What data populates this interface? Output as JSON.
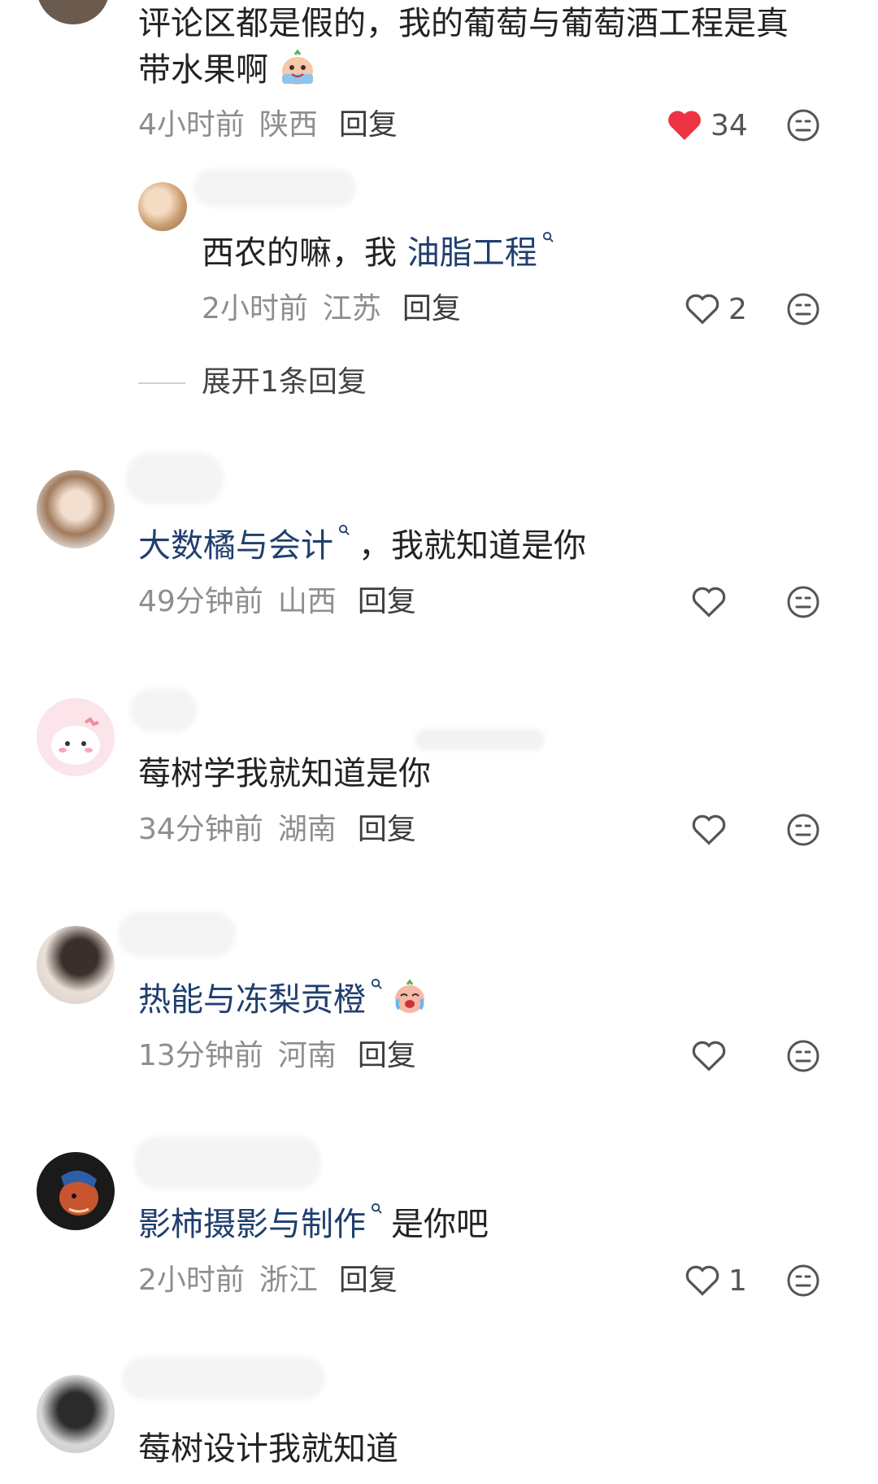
{
  "comments": [
    {
      "text_lines": [
        "评论区都是假的，我的葡萄与葡萄酒工程是真",
        "带水果啊"
      ],
      "time": "4小时前",
      "location": "陕西",
      "reply_label": "回复",
      "likes": "34",
      "liked": true,
      "sub_reply": {
        "mention": "油脂工程",
        "text_prefix": "西农的嘛，我",
        "time": "2小时前",
        "location": "江苏",
        "reply_label": "回复",
        "likes": "2"
      },
      "expand_label": "展开1条回复"
    },
    {
      "mention": "大数橘与会计",
      "text_suffix": "，我就知道是你",
      "time": "49分钟前",
      "location": "山西",
      "reply_label": "回复"
    },
    {
      "text": "莓树学我就知道是你",
      "time": "34分钟前",
      "location": "湖南",
      "reply_label": "回复"
    },
    {
      "mention": "热能与冻梨贡橙",
      "time": "13分钟前",
      "location": "河南",
      "reply_label": "回复"
    },
    {
      "mention": "影柿摄影与制作",
      "text_suffix": "是你吧",
      "time": "2小时前",
      "location": "浙江",
      "reply_label": "回复",
      "likes": "1"
    },
    {
      "text": "莓树设计我就知道"
    }
  ],
  "colors": {
    "liked_heart": "#ee3344",
    "mention": "#1f3f6e",
    "meta": "#8e8e8e"
  },
  "icons": [
    "heart-icon",
    "emoji-reaction-icon",
    "search-mark-icon",
    "crying-emoji-icon",
    "laughing-emoji-icon"
  ]
}
